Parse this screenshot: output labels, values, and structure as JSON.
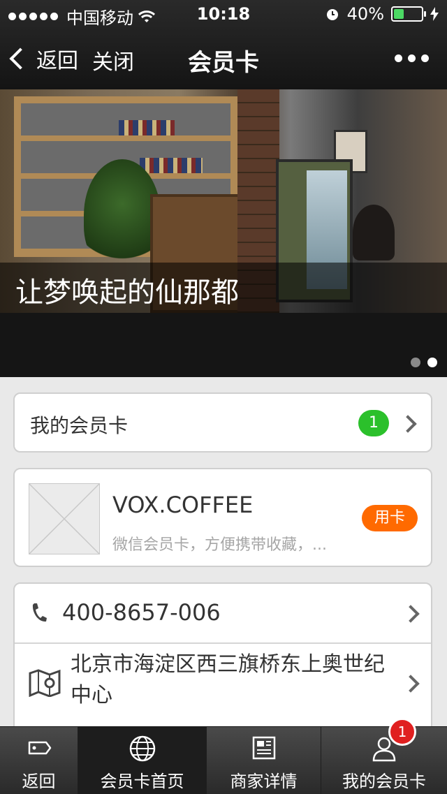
{
  "status_bar": {
    "carrier": "中国移动",
    "time": "10:18",
    "battery_text": "40%",
    "battery_level": 0.4,
    "icons": [
      "signal-dots-icon",
      "wifi-icon",
      "alarm-icon",
      "battery-icon",
      "charging-icon"
    ]
  },
  "nav": {
    "back_label": "返回",
    "close_label": "关闭",
    "title": "会员卡"
  },
  "banner": {
    "caption": "让梦唤起的仙那都",
    "page_count": 2,
    "active_page": 2
  },
  "my_cards": {
    "label": "我的会员卡",
    "count": "1"
  },
  "merchant": {
    "name": "VOX.COFFEE",
    "description": "微信会员卡，方便携带收藏，...",
    "use_button": "用卡"
  },
  "contact": {
    "phone": "400-8657-006",
    "address": "北京市海淀区西三旗桥东上奥世纪中心"
  },
  "tabbar": {
    "tabs": [
      {
        "label": "返回",
        "icon": "tag-icon"
      },
      {
        "label": "会员卡首页",
        "icon": "globe-icon"
      },
      {
        "label": "商家详情",
        "icon": "newspaper-icon"
      },
      {
        "label": "我的会员卡",
        "icon": "user-icon"
      }
    ],
    "active_index": 1,
    "badge": "1"
  },
  "colors": {
    "badge_green": "#2bc02b",
    "use_button_orange": "#ff6a00",
    "tab_badge_red": "#e02020",
    "battery_green": "#4cd964"
  }
}
